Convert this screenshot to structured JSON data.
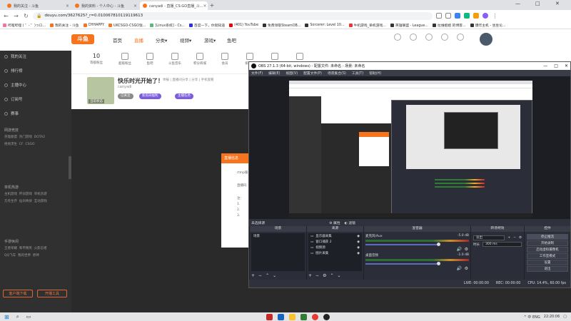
{
  "browser": {
    "tabs": [
      {
        "label": "我的关注 - 斗鱼",
        "active": false,
        "color": "#f7741f"
      },
      {
        "label": "我的资料 - 个人中心 - 斗鱼",
        "active": false,
        "color": "#f7741f"
      },
      {
        "label": "canyadi - 直播_CS:GO直播_斗...",
        "active": true,
        "color": "#f7741f"
      }
    ],
    "url": "douyu.com/3627625?_r=0.010067810119119613",
    "window_controls": [
      "—",
      "□",
      "✕"
    ]
  },
  "bookmarks": [
    {
      "label": "哔哩哔哩 ( ゜- ゜)つロ...",
      "color": "#fb7299"
    },
    {
      "label": "我的关注 - 斗鱼",
      "color": "#f7741f"
    },
    {
      "label": "CHHAPPY",
      "color": "#f7741f"
    },
    {
      "label": "UKCSGO-CSGO饭...",
      "color": "#f7741f"
    },
    {
      "label": "[Linux系统] - Cs...",
      "color": "#5b7"
    },
    {
      "label": "百度一下，你就知道",
      "color": "#2932e1"
    },
    {
      "label": "(401) YouTube",
      "color": "#e00"
    },
    {
      "label": "免费领取SteamOB...",
      "color": "#333"
    },
    {
      "label": "Sorcerer: Level 10...",
      "color": "#333"
    },
    {
      "label": "牛机游戏_单机游戏...",
      "color": "#e33"
    },
    {
      "label": "英雄联盟 - League...",
      "color": "#333"
    },
    {
      "label": "拉维姐姐 的博客...",
      "color": "#333"
    },
    {
      "label": "爆炸主机 - 坐坐论...",
      "color": "#333"
    }
  ],
  "site": {
    "logo": "斗鱼",
    "nav": [
      {
        "label": "首页",
        "active": false
      },
      {
        "label": "直播",
        "active": true
      },
      {
        "label": "分类▾",
        "active": false
      },
      {
        "label": "视频▾",
        "active": false
      },
      {
        "label": "游戏▾",
        "active": false
      },
      {
        "label": "鱼吧",
        "active": false
      }
    ],
    "sidebar": {
      "items": [
        "我的关注",
        "排行榜",
        "主播中心",
        "订阅号",
        "赛事"
      ],
      "sections": [
        {
          "head": "网游竞技",
          "rows": [
            [
              "英雄联盟",
              "热门游戏",
              "DOTA2"
            ],
            [
              "绝地求生",
              "CF",
              "CSGO"
            ]
          ]
        },
        {
          "head": "单机热游",
          "rows": [
            [
              "主机游戏",
              "怀旧游戏",
              "单机热游"
            ],
            [
              "方舟生存",
              "仙剑奇侠",
              "互动游戏"
            ]
          ]
        },
        {
          "head": "手游休闲",
          "rows": [
            [
              "王者荣耀",
              "和平精英",
              "火影忍者"
            ],
            [
              "QQ飞车",
              "我的世界",
              "原神"
            ]
          ]
        }
      ],
      "buttons": [
        "客户端下载",
        "开播工具"
      ]
    },
    "subnav": [
      {
        "label": "10",
        "sub": "等级粉丝"
      },
      {
        "label": "",
        "sub": "超级粉丝"
      },
      {
        "label": "",
        "sub": "鱼吧"
      },
      {
        "label": "",
        "sub": "斗鱼音乐"
      },
      {
        "label": "",
        "sub": "积分商城"
      },
      {
        "label": "",
        "sub": "会员"
      },
      {
        "label": "",
        "sub": "排行榜"
      },
      {
        "label": "",
        "sub": "斗鱼直播"
      },
      {
        "label": "",
        "sub": "小众版"
      }
    ],
    "room": {
      "title": "快乐时光开始了！",
      "anchor": "canyadi",
      "meta": "举报 | 直播间分享 | 分享 | 手机观看",
      "avatar_label": "当前状态",
      "tags": [
        "已关注",
        "新房间福利 ",
        "主播任务 "
      ]
    },
    "popup": {
      "title": "直播信息",
      "lines": [
        "rtmp服",
        "直播码",
        "注：",
        "1.",
        "2.",
        "3."
      ]
    }
  },
  "obs": {
    "title": "OBS 27.1.3 (64-bit, windows) - 配置文件: 未命名 - 场景: 未命名",
    "menu": [
      "文件(F)",
      "编辑(E)",
      "视图(V)",
      "配置文件(P)",
      "场景集合(S)",
      "工具(T)",
      "帮助(H)"
    ],
    "strip": {
      "label": "未选择源",
      "btn1": "属性",
      "btn2": "滤镜"
    },
    "docks": {
      "scenes": {
        "title": "场景",
        "items": [
          "场景"
        ]
      },
      "sources": {
        "title": "来源",
        "items": [
          "显示器采集",
          "窗口捕获 2",
          "视频源",
          "图片采集"
        ]
      },
      "mixer": {
        "title": "混音器",
        "channels": [
          {
            "name": "麦克风/Aux",
            "db": "-5.0 dB"
          },
          {
            "name": "桌面音频",
            "db": "-1.0 dB"
          }
        ]
      },
      "transitions": {
        "title": "转场特效",
        "type": "淡出",
        "duration_label": "时长",
        "duration": "300 ms"
      },
      "controls": {
        "title": "控件",
        "buttons": [
          "停止推流",
          "开始录制",
          "启动虚拟摄像机",
          "工作室模式",
          "设置",
          "退出"
        ]
      }
    },
    "status": {
      "live": "LIVE: 00:00:00",
      "rec": "REC: 00:00:00",
      "cpu": "CPU: 14.4%, 60.00 fps"
    }
  },
  "taskbar": {
    "time": "22:20:06",
    "tray": "^ 中 ENG"
  }
}
